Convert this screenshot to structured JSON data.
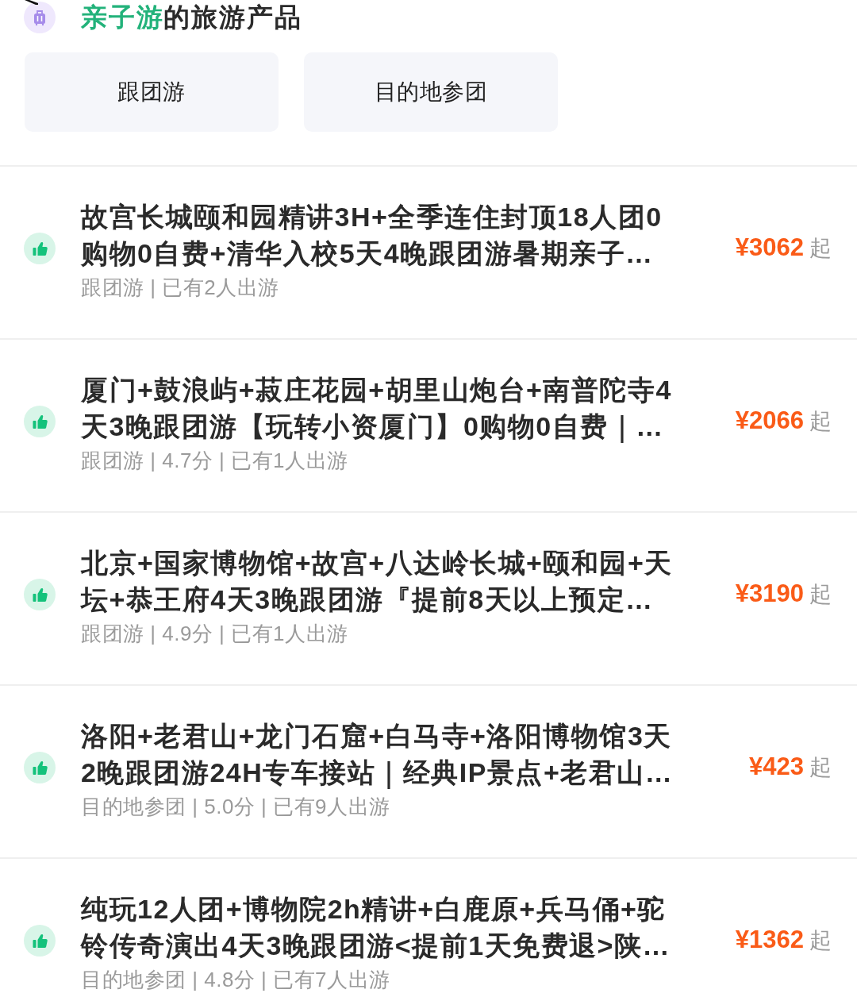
{
  "header": {
    "title_highlight": "亲子游",
    "title_rest": "的旅游产品"
  },
  "filters": [
    "跟团游",
    "目的地参团"
  ],
  "products": [
    {
      "title": "故宫长城颐和园精讲3H+全季连住封顶18人团0购物0自费+清华入校5天4晚跟团游暑期亲子…",
      "meta": "跟团游 | 已有2人出游",
      "price": "¥3062",
      "price_suffix": "起"
    },
    {
      "title": "厦门+鼓浪屿+菽庄花园+胡里山炮台+南普陀寺4天3晚跟团游【玩转小资厦门】0购物0自费｜…",
      "meta": "跟团游 | 4.7分 | 已有1人出游",
      "price": "¥2066",
      "price_suffix": "起"
    },
    {
      "title": "北京+国家博物馆+故宫+八达岭长城+颐和园+天坛+恭王府4天3晚跟团游『提前8天以上预定…",
      "meta": "跟团游 | 4.9分 | 已有1人出游",
      "price": "¥3190",
      "price_suffix": "起"
    },
    {
      "title": "洛阳+老君山+龙门石窟+白马寺+洛阳博物馆3天2晚跟团游24H专车接站｜经典IP景点+老君山…",
      "meta": "目的地参团 | 5.0分 | 已有9人出游",
      "price": "¥423",
      "price_suffix": "起"
    },
    {
      "title": "纯玩12人团+博物院2h精讲+白鹿原+兵马俑+驼铃传奇演出4天3晚跟团游<提前1天免费退>陕…",
      "meta": "目的地参团 | 4.8分 | 已有7人出游",
      "price": "¥1362",
      "price_suffix": "起"
    }
  ]
}
